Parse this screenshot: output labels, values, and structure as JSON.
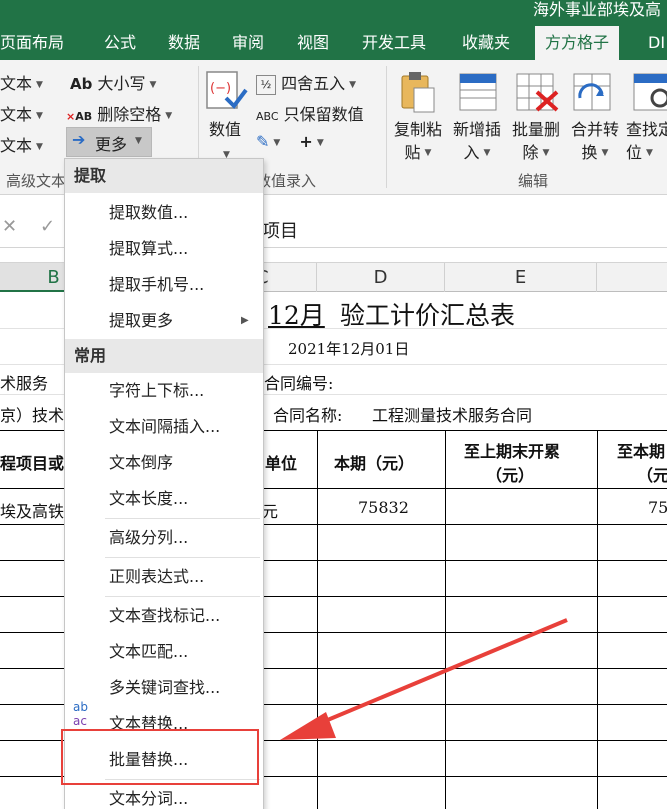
{
  "window": {
    "title": "海外事业部埃及高"
  },
  "ribbon_tabs": [
    {
      "label": "页面布局"
    },
    {
      "label": "公式"
    },
    {
      "label": "数据"
    },
    {
      "label": "审阅"
    },
    {
      "label": "视图"
    },
    {
      "label": "开发工具"
    },
    {
      "label": "收藏夹"
    },
    {
      "label": "方方格子"
    },
    {
      "label": "DI"
    }
  ],
  "ribbon": {
    "left_col": [
      "文本",
      "文本",
      "文本"
    ],
    "case_btn": "大小写",
    "delete_space_btn": "删除空格",
    "more_btn": "更多",
    "round_btn": "四舍五入",
    "keep_value_btn": "只保留数值",
    "value_btn": "数值",
    "copy_paste": [
      "复制粘",
      "贴"
    ],
    "batch_insert": [
      "新增插",
      "入"
    ],
    "batch_delete": [
      "批量删",
      "除"
    ],
    "merge_convert": [
      "合并转",
      "换"
    ],
    "find_locate": [
      "查找定",
      "位"
    ],
    "groups": {
      "advanced_text": "高级文本",
      "value_input": "数值录入",
      "edit": "编辑"
    },
    "icon_text": {
      "ab": "Ab",
      "abc": "ABC"
    }
  },
  "formula_bar": {
    "value": "项目"
  },
  "columns": [
    "B",
    "C",
    "D",
    "E"
  ],
  "sheet": {
    "title_prefix": "12月",
    "title_main": "验工计价汇总表",
    "date": "2021年12月01日",
    "left_text_1": "术服务",
    "contract_no_label": "合同编号:",
    "left_text_2": "京）技术",
    "contract_name_label": "合同名称:",
    "contract_name": "工程测量技术服务合同",
    "headers": {
      "project": "程项目或",
      "unit": "单位",
      "current": "本期（元）",
      "prev_line1": "至上期末开累",
      "prev_line2": "（元）",
      "total_line1": "至本期",
      "total_line2": "（元"
    },
    "row1": {
      "project": "埃及高铁",
      "unit": "元",
      "current": "75832",
      "total": "75"
    }
  },
  "menu": {
    "section_extract": "提取",
    "extract_items": [
      "提取数值...",
      "提取算式...",
      "提取手机号...",
      "提取更多"
    ],
    "section_common": "常用",
    "common_items": [
      "字符上下标...",
      "文本间隔插入...",
      "文本倒序",
      "文本长度...",
      "高级分列...",
      "正则表达式...",
      "文本查找标记...",
      "文本匹配...",
      "多关键词查找...",
      "文本替换...",
      "批量替换...",
      "文本分词..."
    ],
    "replace_icon_text": {
      "top": "ab",
      "bottom": "ac"
    }
  },
  "colors": {
    "excel_green": "#217346",
    "ribbon_bg": "#f3f3f3",
    "annotation_red": "#e8403a"
  }
}
